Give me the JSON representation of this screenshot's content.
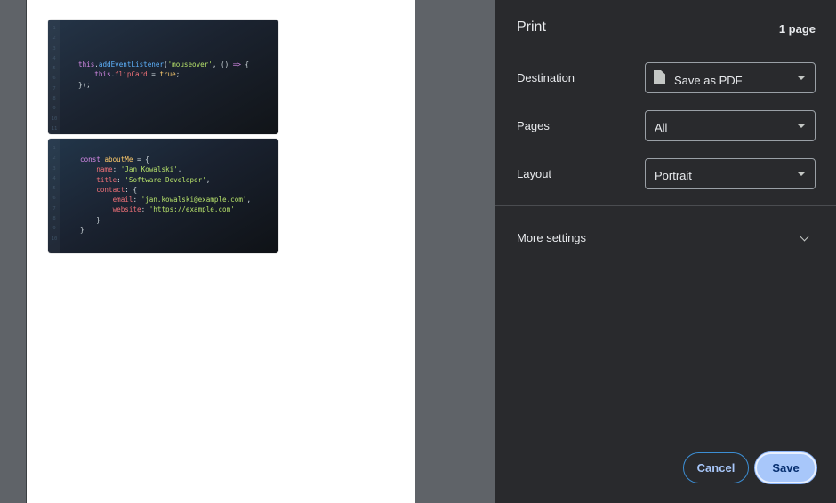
{
  "preview": {
    "card1": {
      "line_numbers": [
        "1",
        "2",
        "3",
        "4",
        "5",
        "6",
        "7",
        "8",
        "9",
        "10",
        "11"
      ],
      "code_lines": [
        [
          {
            "t": "this",
            "c": "kw"
          },
          {
            "t": ".",
            "c": "pl"
          },
          {
            "t": "addEventListener",
            "c": "fn"
          },
          {
            "t": "(",
            "c": "pl"
          },
          {
            "t": "'mouseover'",
            "c": "str2"
          },
          {
            "t": ", () ",
            "c": "pl"
          },
          {
            "t": "=>",
            "c": "kw"
          },
          {
            "t": " {",
            "c": "pl"
          }
        ],
        [
          {
            "t": "    this",
            "c": "kw"
          },
          {
            "t": ".",
            "c": "pl"
          },
          {
            "t": "flipCard",
            "c": "prop"
          },
          {
            "t": " = ",
            "c": "pl"
          },
          {
            "t": "true",
            "c": "bool"
          },
          {
            "t": ";",
            "c": "pl"
          }
        ],
        [
          {
            "t": "});",
            "c": "pl"
          }
        ]
      ]
    },
    "card2": {
      "line_numbers": [
        "1",
        "2",
        "3",
        "4",
        "5",
        "6",
        "7",
        "8",
        "9",
        "10"
      ],
      "code_lines": [
        [
          {
            "t": "const ",
            "c": "kw"
          },
          {
            "t": "aboutMe",
            "c": "var"
          },
          {
            "t": " = {",
            "c": "pl"
          }
        ],
        [
          {
            "t": "    name",
            "c": "prop"
          },
          {
            "t": ": ",
            "c": "pl"
          },
          {
            "t": "'Jan Kowalski'",
            "c": "str2"
          },
          {
            "t": ",",
            "c": "pl"
          }
        ],
        [
          {
            "t": "    title",
            "c": "prop"
          },
          {
            "t": ": ",
            "c": "pl"
          },
          {
            "t": "'Software Developer'",
            "c": "str2"
          },
          {
            "t": ",",
            "c": "pl"
          }
        ],
        [
          {
            "t": "    contact",
            "c": "prop"
          },
          {
            "t": ": {",
            "c": "pl"
          }
        ],
        [
          {
            "t": "        email",
            "c": "prop"
          },
          {
            "t": ": ",
            "c": "pl"
          },
          {
            "t": "'jan.kowalski@example.com'",
            "c": "str2"
          },
          {
            "t": ",",
            "c": "pl"
          }
        ],
        [
          {
            "t": "        website",
            "c": "prop"
          },
          {
            "t": ": ",
            "c": "pl"
          },
          {
            "t": "'https://example.com'",
            "c": "str2"
          }
        ],
        [
          {
            "t": "    }",
            "c": "pl"
          }
        ],
        [
          {
            "t": "}",
            "c": "pl"
          }
        ]
      ]
    }
  },
  "panel": {
    "title": "Print",
    "page_count": "1 page",
    "destination": {
      "label": "Destination",
      "value": "Save as PDF",
      "icon": "file-icon"
    },
    "pages": {
      "label": "Pages",
      "value": "All"
    },
    "layout": {
      "label": "Layout",
      "value": "Portrait"
    },
    "more_settings": "More settings",
    "cancel_label": "Cancel",
    "save_label": "Save"
  },
  "colors": {
    "panel_bg": "#292a2d",
    "accent": "#a8c7fa",
    "preview_bg": "#5f6368"
  }
}
